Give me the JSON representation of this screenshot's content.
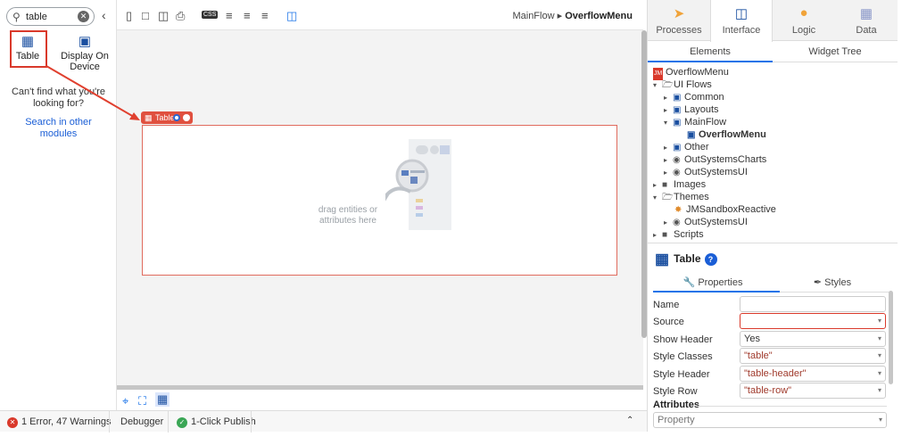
{
  "search": {
    "value": "table"
  },
  "widgets": [
    {
      "label": "Table"
    },
    {
      "label": "Display On Device"
    }
  ],
  "not_found_text": "Can't find what you're looking for?",
  "search_other": "Search in other modules",
  "breadcrumb": {
    "flow": "MainFlow",
    "screen": "OverflowMenu"
  },
  "canvas": {
    "widget_tag": "Table",
    "drag_text": "drag entities or attributes here"
  },
  "status": {
    "errors": "1 Error, 47 Warnings",
    "debugger": "Debugger",
    "publish": "1-Click Publish"
  },
  "top_tabs": [
    {
      "label": "Processes"
    },
    {
      "label": "Interface"
    },
    {
      "label": "Logic"
    },
    {
      "label": "Data"
    }
  ],
  "sub_tabs": [
    "Elements",
    "Widget Tree"
  ],
  "tree": {
    "root": "OverflowMenu",
    "ui_flows": "UI Flows",
    "common": "Common",
    "layouts": "Layouts",
    "mainflow": "MainFlow",
    "overflowmenu": "OverflowMenu",
    "other": "Other",
    "outsystemscharts": "OutSystemsCharts",
    "outsystemsui": "OutSystemsUI",
    "images": "Images",
    "themes": "Themes",
    "jmsandbox": "JMSandboxReactive",
    "outsystemsui2": "OutSystemsUI",
    "scripts": "Scripts"
  },
  "widget_panel": {
    "title": "Table",
    "tabs": [
      "Properties",
      "Styles"
    ],
    "props": [
      {
        "label": "Name",
        "value": ""
      },
      {
        "label": "Source",
        "value": ""
      },
      {
        "label": "Show Header",
        "value": "Yes"
      },
      {
        "label": "Style Classes",
        "value": "\"table\""
      },
      {
        "label": "Style Header",
        "value": "\"table-header\""
      },
      {
        "label": "Style Row",
        "value": "\"table-row\""
      }
    ],
    "attributes_label": "Attributes",
    "property_placeholder": "Property"
  },
  "colors": {
    "accent": "#1a73e8",
    "error": "#d9392b",
    "tag": "#e0503f"
  }
}
